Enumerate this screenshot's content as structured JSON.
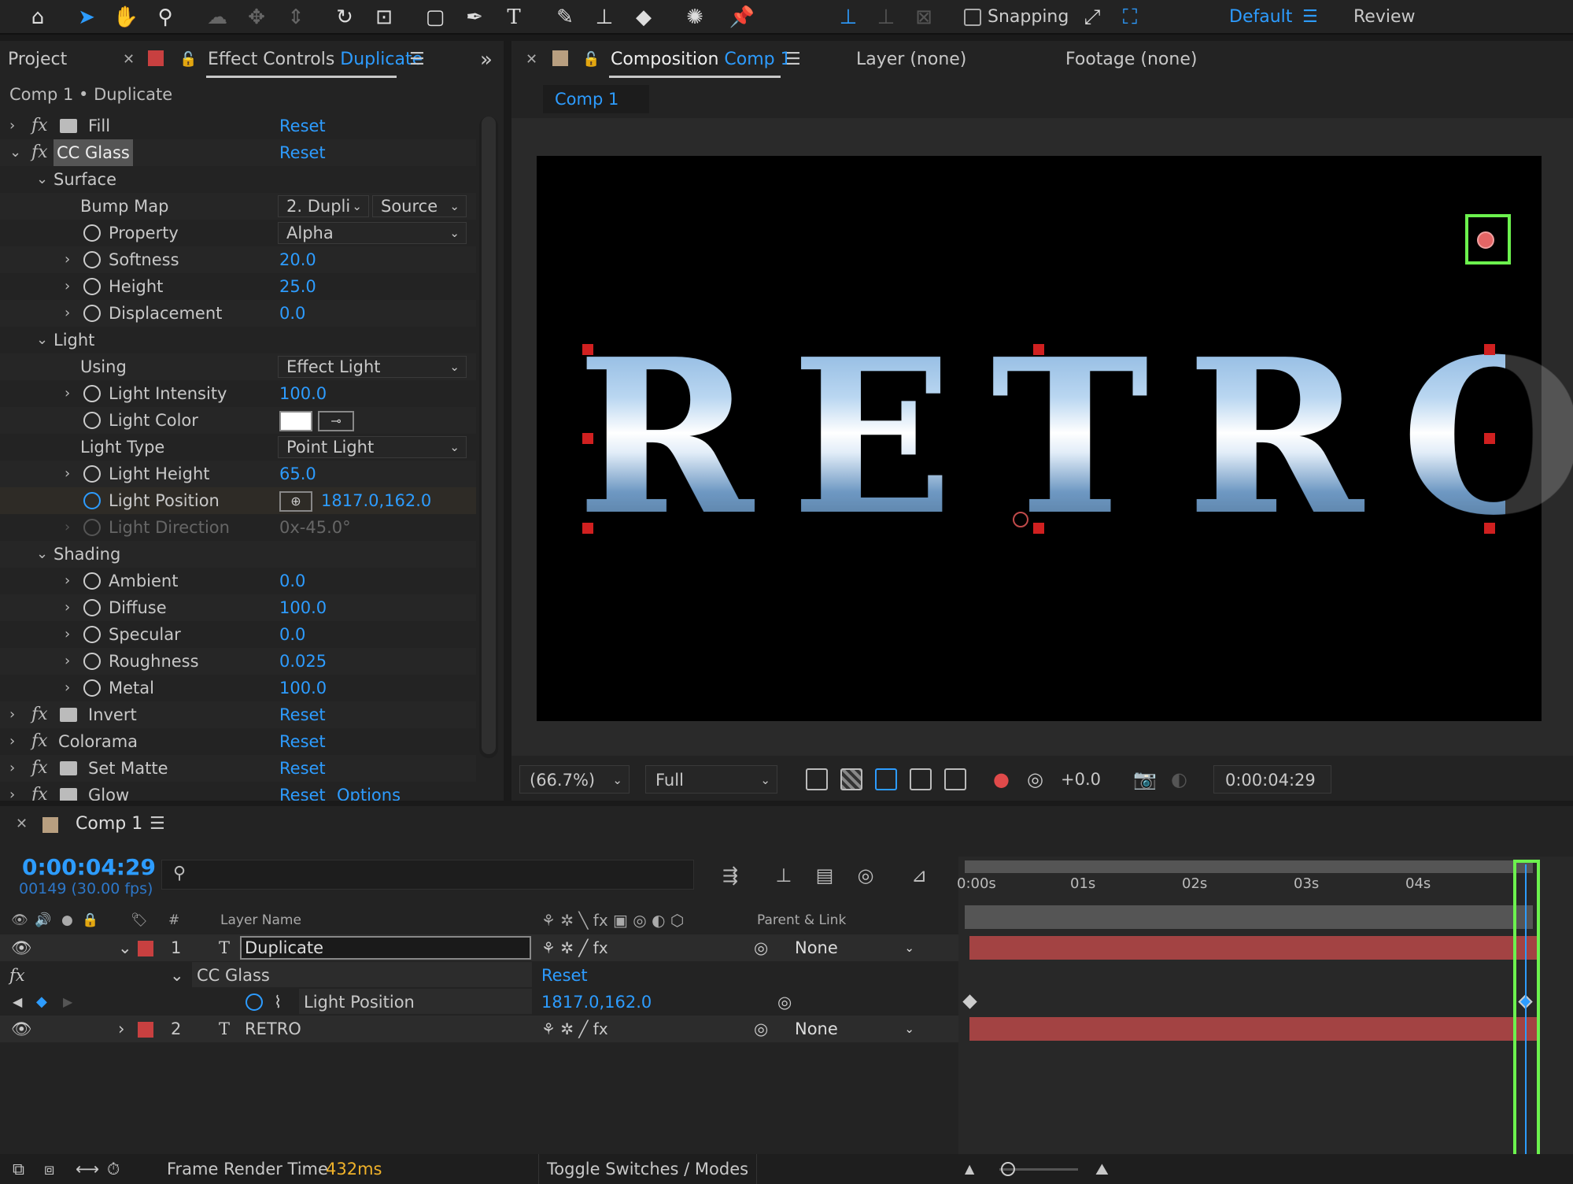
{
  "toolbar": {
    "snapping_label": "Snapping",
    "workspace_default": "Default",
    "workspace_review": "Review",
    "icons": [
      "home-icon",
      "selection-tool-icon",
      "hand-tool-icon",
      "zoom-tool-icon",
      "orbit-tool-icon",
      "pan-tool-icon",
      "dolly-tool-icon",
      "rotate-tool-icon",
      "pan-behind-tool-icon",
      "rectangle-tool-icon",
      "pen-tool-icon",
      "type-tool-icon",
      "brush-tool-icon",
      "clone-stamp-tool-icon",
      "eraser-tool-icon",
      "roto-brush-tool-icon",
      "puppet-pin-tool-icon"
    ]
  },
  "left_panel": {
    "tab_project": "Project",
    "tab_effect_controls_prefix": "Effect Controls",
    "tab_effect_controls_layer": "Duplicate",
    "breadcrumb": "Comp 1 • Duplicate",
    "rows": [
      {
        "name": "Fill",
        "value": "Reset"
      },
      {
        "name": "CC Glass",
        "value": "Reset"
      },
      {
        "name": "Surface"
      },
      {
        "name": "Bump Map",
        "value1": "2. Dupli",
        "value2": "Source"
      },
      {
        "name": "Property",
        "value": "Alpha"
      },
      {
        "name": "Softness",
        "value": "20.0"
      },
      {
        "name": "Height",
        "value": "25.0"
      },
      {
        "name": "Displacement",
        "value": "0.0"
      },
      {
        "name": "Light"
      },
      {
        "name": "Using",
        "value": "Effect Light"
      },
      {
        "name": "Light Intensity",
        "value": "100.0"
      },
      {
        "name": "Light Color"
      },
      {
        "name": "Light Type",
        "value": "Point Light"
      },
      {
        "name": "Light Height",
        "value": "65.0"
      },
      {
        "name": "Light Position",
        "value": "1817.0,162.0"
      },
      {
        "name": "Light Direction",
        "value": "0x-45.0°"
      },
      {
        "name": "Shading"
      },
      {
        "name": "Ambient",
        "value": "0.0"
      },
      {
        "name": "Diffuse",
        "value": "100.0"
      },
      {
        "name": "Specular",
        "value": "0.0"
      },
      {
        "name": "Roughness",
        "value": "0.025"
      },
      {
        "name": "Metal",
        "value": "100.0"
      },
      {
        "name": "Invert",
        "value": "Reset"
      },
      {
        "name": "Colorama",
        "value": "Reset"
      },
      {
        "name": "Set Matte",
        "value": "Reset"
      },
      {
        "name": "Glow",
        "value": "Reset",
        "value2": "Options"
      }
    ]
  },
  "composition": {
    "tab_prefix": "Composition",
    "tab_comp": "Comp 1",
    "tab_layer": "Layer (none)",
    "tab_footage": "Footage (none)",
    "sub_tab": "Comp 1",
    "canvas_text": "RETRO",
    "zoom": "(66.7%)",
    "resolution": "Full",
    "exposure": "+0.0",
    "timecode": "0:00:04:29"
  },
  "timeline": {
    "tab": "Comp 1",
    "current_time": "0:00:04:29",
    "frames": "00149 (30.00 fps)",
    "col_layer_name": "Layer Name",
    "col_parent": "Parent & Link",
    "col_hash": "#",
    "ruler": [
      "0:00s",
      "01s",
      "02s",
      "03s",
      "04s"
    ],
    "layers": [
      {
        "num": "1",
        "name": "Duplicate",
        "parent": "None"
      },
      {
        "num": "2",
        "name": "RETRO",
        "parent": "None"
      }
    ],
    "effect_name": "CC Glass",
    "effect_reset": "Reset",
    "property_name": "Light Position",
    "property_value": "1817.0,162.0"
  },
  "status": {
    "frame_render_label": "Frame Render Time",
    "frame_render_value": "432ms",
    "toggle_label": "Toggle Switches / Modes"
  },
  "colors": {
    "accent_blue": "#2d9cff",
    "highlight_green": "#6cf24e",
    "label_red": "#c84040",
    "render_time_yellow": "#f0b22a"
  }
}
